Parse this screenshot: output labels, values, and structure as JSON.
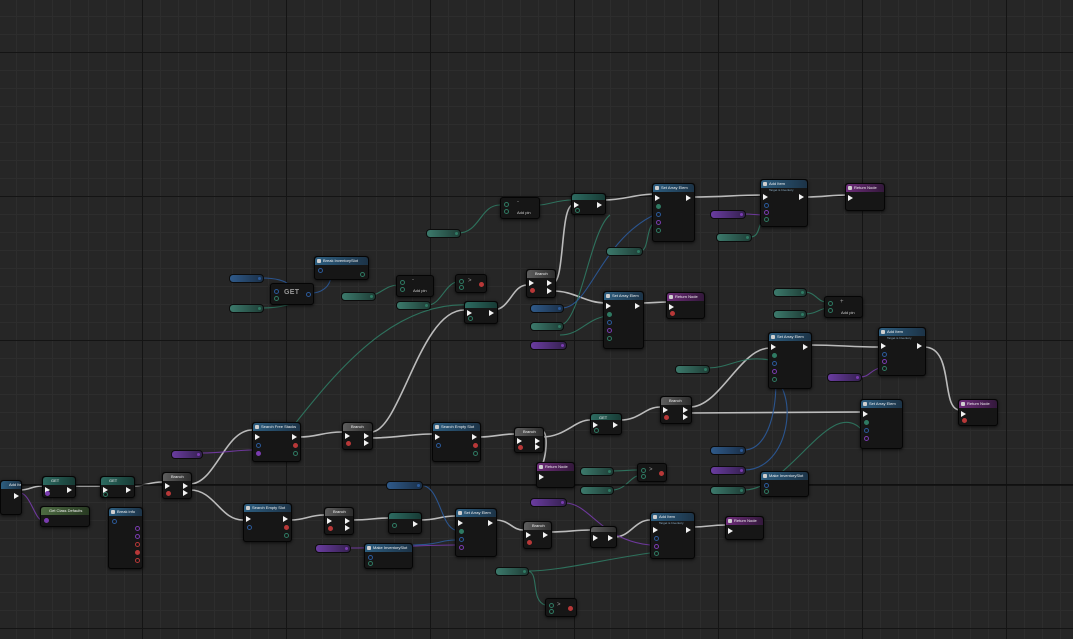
{
  "graph": {
    "background": "#262626",
    "wire_colors": {
      "exec": "#d8d8d8",
      "teal": "#2f7a63",
      "blue": "#2b5a9a",
      "purple": "#7a3cb0"
    },
    "nodes": {
      "add_item_left": "Add Item",
      "get_top": "GET",
      "get_bottom": "GET",
      "get_class_defaults": "Get Class Defaults",
      "break_info": "Break info",
      "branch_a": "Branch",
      "search_free_stacks": "Search Free Stacks",
      "branch_b": "Branch",
      "search_empty_slot_mid": "Search Empty Slot",
      "branch_c": "Branch",
      "search_empty_slot_low": "Search Empty Slot",
      "branch_d": "Branch",
      "set_array_elem_low": "Set Array Elem",
      "make_inventory_slot_low": "Make InventorySlot",
      "branch_e": "Branch",
      "add_item_low": "Add Item",
      "add_item_low_sub": "Target is Inventory",
      "return_node_low": "Return Node",
      "return_node_mid": "Return Node",
      "break_inventory_slot": "Break InventorySlot",
      "get_big": "GET",
      "branch_top": "Branch",
      "set_array_elem_top": "Set Array Elem",
      "set_array_elem_mid": "Set Array Elem",
      "return_node_center": "Return Node",
      "add_item_top": "Add Item",
      "add_item_top_sub": "Target is Inventory",
      "return_node_top": "Return Node",
      "branch_f": "Branch",
      "get_mid": "GET",
      "set_array_elem_right": "Set Array Elem",
      "add_item_right": "Add Item",
      "add_item_right_sub": "Target is Inventory",
      "set_array_elem_far": "Set Array Elem",
      "return_node_far": "Return Node",
      "make_inventory_slot_right": "Make InventorySlot",
      "add_pin": "Add pin"
    }
  }
}
